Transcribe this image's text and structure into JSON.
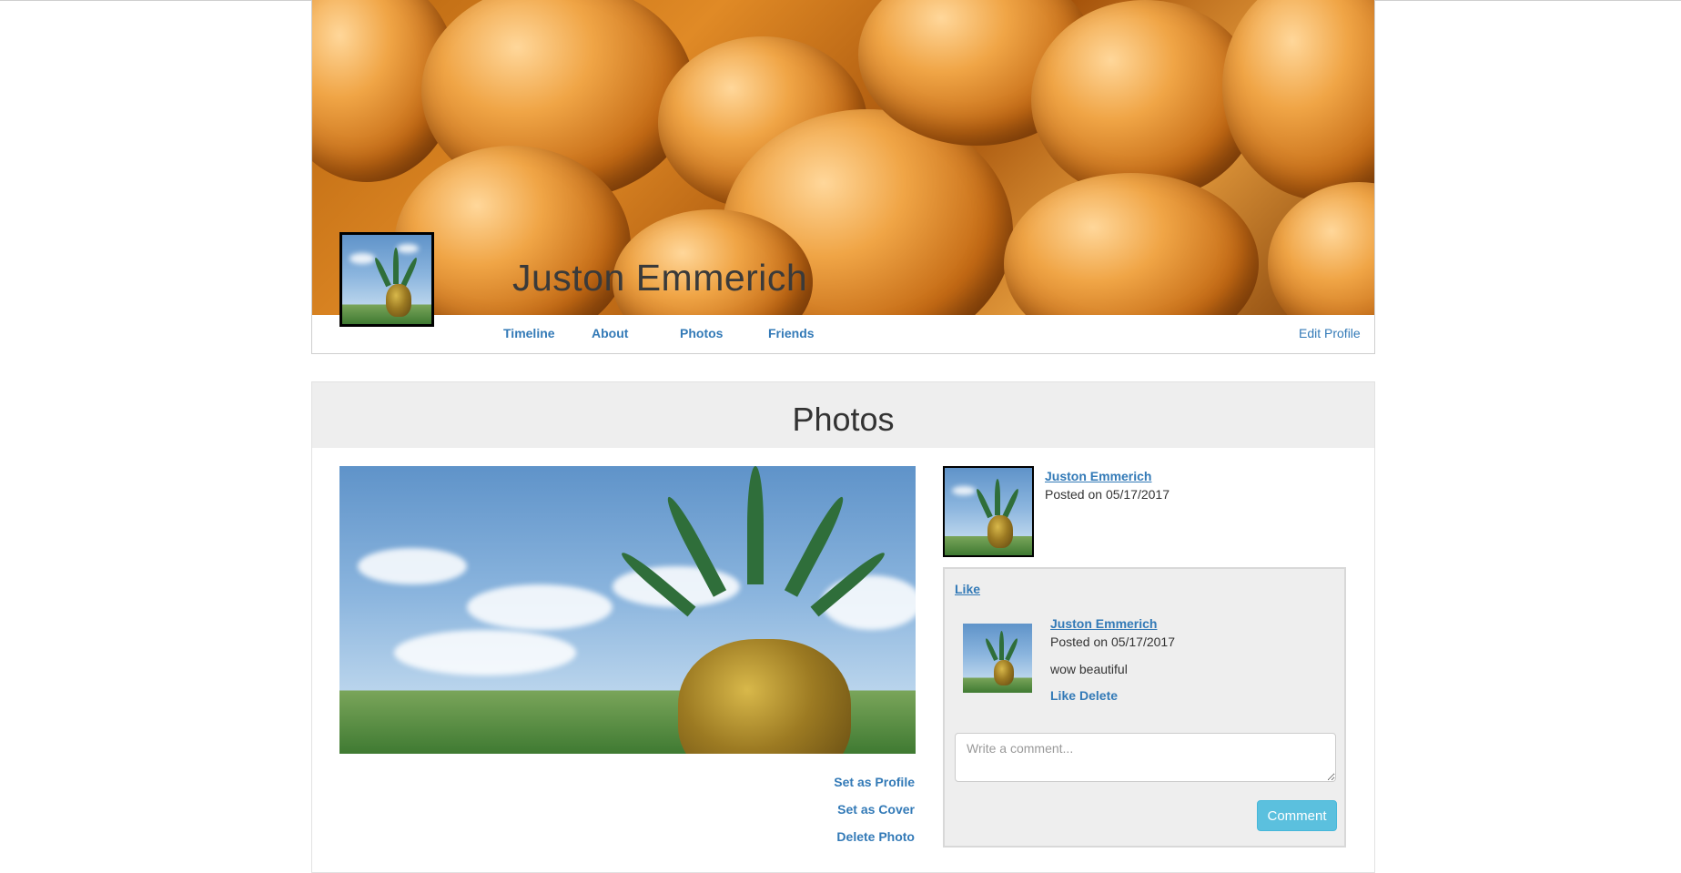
{
  "profile": {
    "name": "Juston Emmerich"
  },
  "nav": {
    "timeline": "Timeline",
    "about": "About",
    "photos": "Photos",
    "friends": "Friends",
    "edit_profile": "Edit Profile"
  },
  "photos_section": {
    "title": "Photos",
    "actions": {
      "set_profile": "Set as Profile",
      "set_cover": "Set as Cover",
      "delete_photo": "Delete Photo"
    }
  },
  "post": {
    "author": "Juston Emmerich",
    "date": "Posted on 05/17/2017",
    "like_label": "Like"
  },
  "comment": {
    "author": "Juston Emmerich",
    "date": "Posted on 05/17/2017",
    "text": "wow beautiful",
    "like_label": "Like",
    "delete_label": "Delete"
  },
  "comment_form": {
    "placeholder": "Write a comment...",
    "submit_label": "Comment"
  },
  "colors": {
    "link": "#337ab7",
    "button": "#5bc0de",
    "panel_bg": "#eeeeee"
  },
  "icons": [
    "cover-photo-image",
    "profile-avatar-image",
    "pineapple-photo-image"
  ]
}
